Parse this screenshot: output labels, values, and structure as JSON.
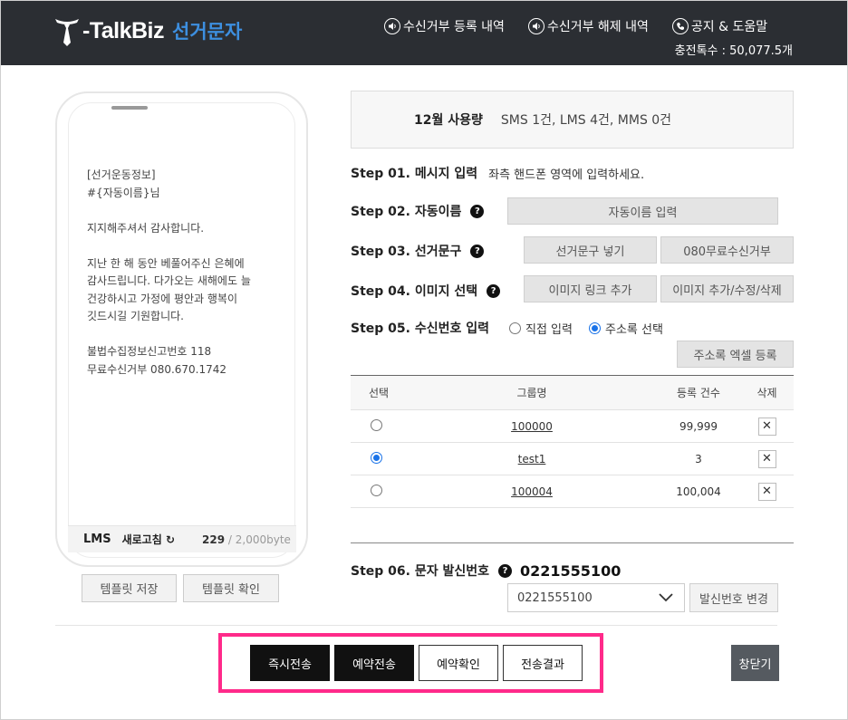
{
  "header": {
    "brand": "-TalkBiz",
    "brand_sub": "선거문자",
    "nav": [
      {
        "label": "수신거부 등록 내역",
        "icon": "speaker-icon"
      },
      {
        "label": "수신거부 해제 내역",
        "icon": "speaker-icon"
      },
      {
        "label": "공지 & 도움말",
        "icon": "phone-icon"
      }
    ],
    "charge": "충전톡수 : 50,077.5개"
  },
  "phone": {
    "message_lines": [
      {
        "text": "[선거운동정보]"
      },
      {
        "text": "#{자동이름}님"
      },
      {
        "text": ""
      },
      {
        "text": "지지해주셔서 감사합니다."
      },
      {
        "text": ""
      },
      {
        "text": "지난 한 해 동안 베풀어주신 은혜에"
      },
      {
        "text": "감사드립니다. 다가오는 새해에도 늘"
      },
      {
        "text": "건강하시고 가정에 평안과 행복이"
      },
      {
        "text": "깃드시길 기원합니다."
      },
      {
        "text": ""
      },
      {
        "text": "불법수집정보신고번호 118"
      },
      {
        "text": "무료수신거부 080.670.1742"
      }
    ],
    "type": "LMS",
    "refresh": "새로고침",
    "bytes_used": "229",
    "bytes_max": "/ 2,000byte"
  },
  "template_buttons": {
    "save": "템플릿 저장",
    "check": "템플릿 확인"
  },
  "usage": {
    "label": "12월 사용량",
    "value": "SMS 1건,  LMS 4건,  MMS 0건"
  },
  "steps": {
    "s1": {
      "title": "Step 01. 메시지 입력",
      "hint": "좌측 핸드폰 영역에 입력하세요."
    },
    "s2": {
      "title": "Step 02. 자동이름",
      "button": "자동이름 입력"
    },
    "s3": {
      "title": "Step 03. 선거문구",
      "button1": "선거문구 넣기",
      "button2": "080무료수신거부"
    },
    "s4": {
      "title": "Step 04. 이미지 선택",
      "button1": "이미지 링크 추가",
      "button2": "이미지 추가/수정/삭제"
    },
    "s5": {
      "title": "Step 05. 수신번호 입력",
      "option1": "직접 입력",
      "option2": "주소록 선택",
      "selected": "주소록 선택",
      "excel_button": "주소록 엑셀 등록"
    },
    "s6": {
      "title": "Step 06. 문자 발신번호",
      "number": "0221555100",
      "select_value": "0221555100",
      "change_button": "발신번호 변경"
    }
  },
  "table": {
    "headers": [
      "선택",
      "그룹명",
      "등록 건수",
      "삭제"
    ],
    "rows": [
      {
        "group": "100000",
        "count": "99,999",
        "selected": false
      },
      {
        "group": "test1",
        "count": "3",
        "selected": true
      },
      {
        "group": "100004",
        "count": "100,004",
        "selected": false
      }
    ]
  },
  "actions": {
    "send_now": "즉시전송",
    "send_reserve": "예약전송",
    "reserve_check": "예약확인",
    "send_result": "전송결과",
    "close": "창닫기"
  },
  "colors": {
    "header_bg": "#2b2e33",
    "brand_accent": "#3d8fe0",
    "highlight_border": "#ff2a8a",
    "radio_on": "#1a73e8"
  }
}
